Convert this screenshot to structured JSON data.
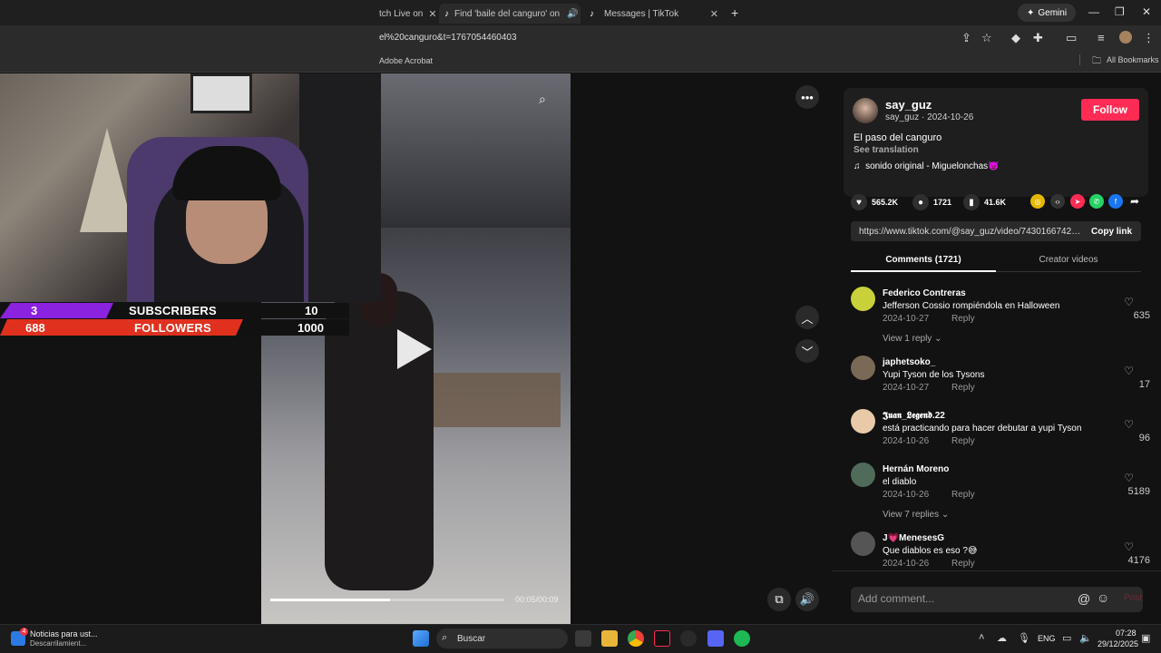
{
  "browser": {
    "tabs": [
      {
        "title": "tch Live on"
      },
      {
        "title": "Find 'baile del canguro' on"
      },
      {
        "title": "Messages | TikTok"
      }
    ],
    "gemini_label": "Gemini",
    "url": "el%20canguro&t=1767054460403",
    "bookmarks": {
      "acrobat": "Adobe Acrobat",
      "all": "All Bookmarks"
    }
  },
  "stream_overlay": {
    "subscribers_count": "3",
    "subscribers_label": "SUBSCRIBERS",
    "subscribers_goal": "10",
    "followers_count": "688",
    "followers_label": "FOLLOWERS",
    "followers_goal": "1000"
  },
  "video": {
    "time": "00:05/00:09",
    "progress": 0.51
  },
  "post": {
    "username": "say_guz",
    "subline": "say_guz · 2024-10-26",
    "follow_label": "Follow",
    "description": "El paso del canguro",
    "see_translation": "See translation",
    "music": "sonido original - Miguelonchas👿",
    "likes": "565.2K",
    "comments": "1721",
    "saves": "41.6K",
    "link": "https://www.tiktok.com/@say_guz/video/74301667424...",
    "copy_link": "Copy link",
    "tab_comments": "Comments (1721)",
    "tab_creator": "Creator videos"
  },
  "comments": [
    {
      "name": "Federico Contreras",
      "text": "Jefferson Cossio rompiéndola en Halloween",
      "date": "2024-10-27",
      "reply": "Reply",
      "likes": "635",
      "view_replies": "View 1 reply ⌄",
      "avatar_color": "#c8d03a"
    },
    {
      "name": "japhetsoko_",
      "text": "Yupi Tyson de los Tysons",
      "date": "2024-10-27",
      "reply": "Reply",
      "likes": "17",
      "view_replies": "",
      "avatar_color": "#7a6a55"
    },
    {
      "name": "𝕵𝖚𝖆𝖓_𝕷𝖊𝖌𝖊𝖓𝖉.22",
      "text": "está practicando para hacer debutar a yupi Tyson",
      "date": "2024-10-26",
      "reply": "Reply",
      "likes": "96",
      "view_replies": "",
      "avatar_color": "#e8c9a8"
    },
    {
      "name": "Hernán Moreno",
      "text": "el diablo",
      "date": "2024-10-26",
      "reply": "Reply",
      "likes": "5189",
      "view_replies": "View 7 replies ⌄",
      "avatar_color": "#4f6b5a"
    },
    {
      "name": "J💗MenesesG",
      "text": "Que diablos es eso ?😅",
      "date": "2024-10-26",
      "reply": "Reply",
      "likes": "4176",
      "view_replies": "",
      "avatar_color": "#555"
    }
  ],
  "add_comment_placeholder": "Add comment...",
  "post_button": "Post",
  "taskbar": {
    "news_title": "Noticias para ust...",
    "news_sub": "Descarrilamient...",
    "news_badge": "4",
    "search": "Buscar",
    "lang": "ENG",
    "time": "07:28",
    "date": "29/12/2025"
  },
  "colors": {
    "accent": "#fe2c55",
    "overlay_purple": "#8a22e0",
    "overlay_red": "#e0301e"
  }
}
